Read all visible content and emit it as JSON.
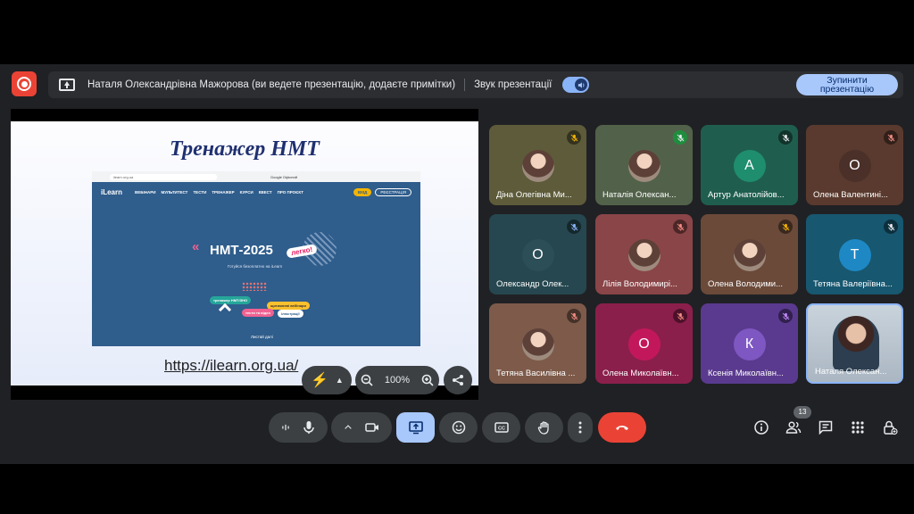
{
  "presenting_bar": {
    "presenter_text": "Наталя Олександрівна Мажорова (ви ведете презентацію, додаєте примітки)",
    "audio_label": "Звук презентації",
    "stop_button": "Зупинити презентацію"
  },
  "slide": {
    "title": "Тренажер НМТ",
    "link": "https://ilearn.org.ua/",
    "screenshot": {
      "url": "ilearn.org.ua",
      "search_hint": "Google Офісний",
      "logo": "iLearn",
      "nav": [
        "ВЕБІНАРИ",
        "МУЛЬТИТЕСТ",
        "ТЕСТИ",
        "ТРЕНАЖЕР",
        "КУРСИ",
        "КВЕСТ",
        "ПРО ПРОЄКТ"
      ],
      "login": "ВХІД",
      "register": "РЕЄСТРАЦІЯ",
      "hero": "НМТ-2025",
      "badge": "легко!",
      "subtitle": "Готуйся безоплатно на iLearn",
      "pill1": "тренажер НМТ/ЗНО",
      "pill2": "щотижневі вебінари",
      "pill3": "тести та відео",
      "pill4": "ілюстрації",
      "more": "Листай далі"
    }
  },
  "slide_controls": {
    "zoom_level": "100%"
  },
  "tiles": [
    {
      "name": "Діна Олегівна Ми...",
      "initial": "",
      "bg": "#5d5b3a"
    },
    {
      "name": "Наталія Олексан...",
      "initial": "",
      "bg": "#52624a"
    },
    {
      "name": "Артур Анатолійов...",
      "initial": "А",
      "bg": "#1f5e4e",
      "avatar_bg": "#1e8e6e"
    },
    {
      "name": "Олена Валентині...",
      "initial": "О",
      "bg": "#5a3a2e",
      "avatar_bg": "#4a3028"
    },
    {
      "name": "Олександр Олек...",
      "initial": "О",
      "bg": "#26474f",
      "avatar_bg": "#2b4e57"
    },
    {
      "name": "Лілія Володимирі...",
      "initial": "",
      "bg": "#8a4548"
    },
    {
      "name": "Олена Володими...",
      "initial": "",
      "bg": "#6b4a3a"
    },
    {
      "name": "Тетяна Валеріївна...",
      "initial": "Т",
      "bg": "#17576f",
      "avatar_bg": "#1e88c5"
    },
    {
      "name": "Тетяна Василівна ...",
      "initial": "",
      "bg": "#7d5a4a"
    },
    {
      "name": "Олена Миколаївн...",
      "initial": "О",
      "bg": "#8b1f4c",
      "avatar_bg": "#c2185b"
    },
    {
      "name": "Ксенія Миколаївн...",
      "initial": "К",
      "bg": "#5a3a8e",
      "avatar_bg": "#7e57c2"
    },
    {
      "name": "Наталя Олексан...",
      "initial": "",
      "bg": "#b7c2cc"
    }
  ],
  "toolbar": {
    "participant_count": "13"
  },
  "colors": {
    "accent": "#a8c7fa",
    "end_call": "#ea4335",
    "record": "#ea4335"
  }
}
